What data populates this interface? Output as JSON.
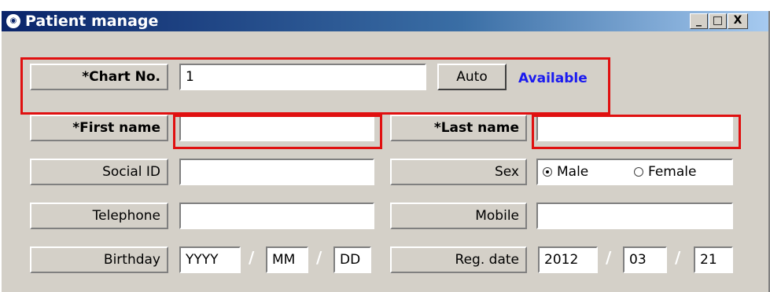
{
  "window": {
    "title": "Patient manage",
    "icon": "app-logo-icon",
    "controls": [
      "_",
      "□",
      "X"
    ]
  },
  "form": {
    "chart_no": {
      "label": "*Chart No.",
      "value": "1",
      "button": "Auto",
      "status": "Available",
      "status_color": "#1a1af0"
    },
    "first_name": {
      "label": "*First name",
      "value": ""
    },
    "last_name": {
      "label": "*Last name",
      "value": ""
    },
    "social_id": {
      "label": "Social ID",
      "value": ""
    },
    "sex": {
      "label": "Sex",
      "options": [
        "Male",
        "Female"
      ],
      "selected": "Male"
    },
    "telephone": {
      "label": "Telephone",
      "value": ""
    },
    "mobile": {
      "label": "Mobile",
      "value": ""
    },
    "birthday": {
      "label": "Birthday",
      "year": "YYYY",
      "month": "MM",
      "day": "DD",
      "separator": "/"
    },
    "reg_date": {
      "label": "Reg. date",
      "year": "2012",
      "month": "03",
      "day": "21",
      "separator": "/"
    }
  },
  "highlight_color": "#e01010"
}
